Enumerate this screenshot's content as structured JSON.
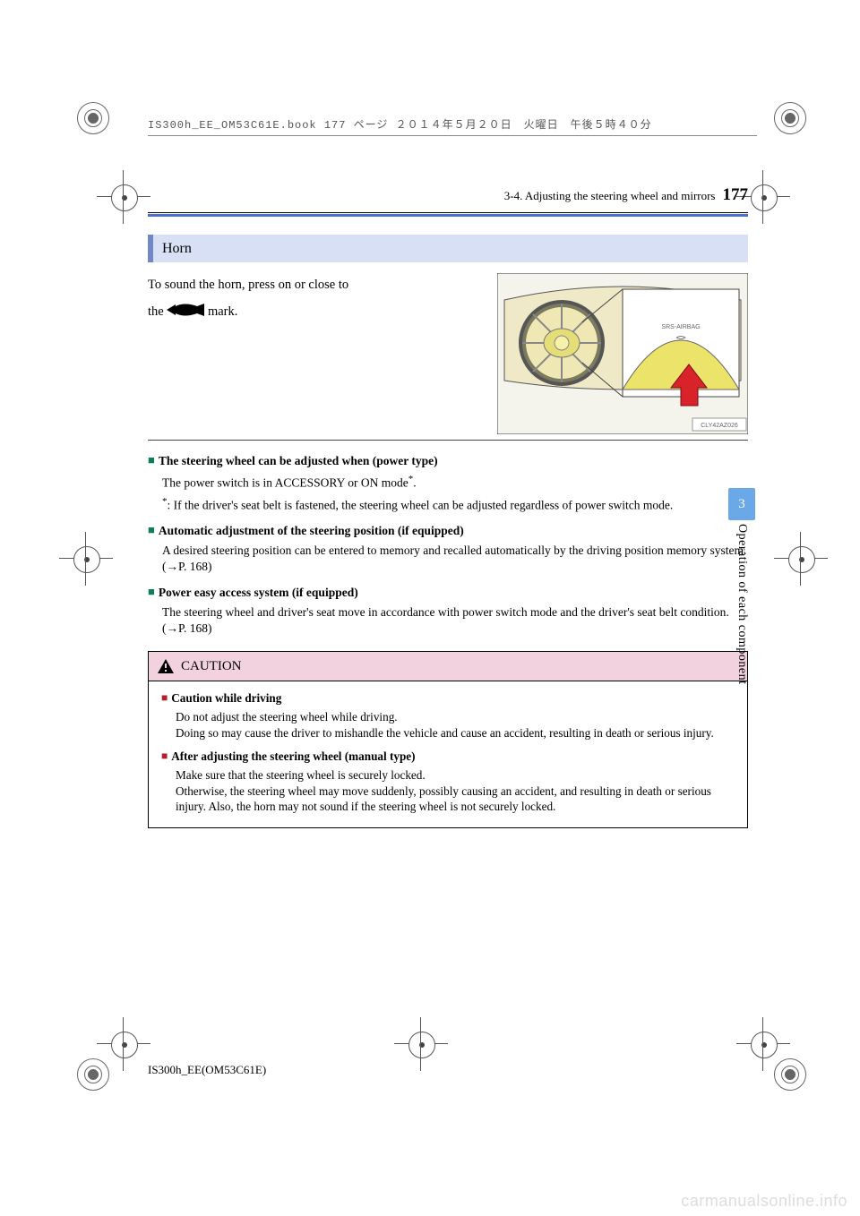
{
  "print_header": "IS300h_EE_OM53C61E.book  177 ページ  ２０１４年５月２０日　火曜日　午後５時４０分",
  "header": {
    "section": "3-4. Adjusting the steering wheel and mirrors",
    "page": "177"
  },
  "horn": {
    "title": "Horn",
    "line1": "To sound the horn, press on or close to",
    "line2a": "the",
    "line2b": "mark."
  },
  "illustration": {
    "airbag_label": "SRS-AIRBAG",
    "code": "CLY42AZ026"
  },
  "notes": [
    {
      "title": "The steering wheel can be adjusted when (power type)",
      "p1": "The power switch is in ACCESSORY or ON mode",
      "p1_sup": "*",
      "p1_end": ".",
      "p2_pre": "*",
      "p2": ": If the driver's seat belt is fastened, the steering wheel can be adjusted regardless of power switch mode."
    },
    {
      "title": "Automatic adjustment of the steering position (if equipped)",
      "p1": "A desired steering position can be entered to memory and recalled automatically by the driving position memory system. (→P. 168)"
    },
    {
      "title": "Power easy access system (if equipped)",
      "p1": "The steering wheel and driver's seat move in accordance with power switch mode and the driver's seat belt condition. (→P. 168)"
    }
  ],
  "caution": {
    "title": "CAUTION",
    "items": [
      {
        "title": "Caution while driving",
        "p": "Do not adjust the steering wheel while driving.\nDoing so may cause the driver to mishandle the vehicle and cause an accident, resulting in death or serious injury."
      },
      {
        "title": "After adjusting the steering wheel (manual type)",
        "p": "Make sure that the steering wheel is securely locked.\nOtherwise, the steering wheel may move suddenly, possibly causing an accident, and resulting in death or serious injury. Also, the horn may not sound if the steering wheel is not securely locked."
      }
    ]
  },
  "side_tab": "3",
  "side_text": "Operation of each component",
  "footer_code": "IS300h_EE(OM53C61E)",
  "watermark": "carmanualsonline.info"
}
